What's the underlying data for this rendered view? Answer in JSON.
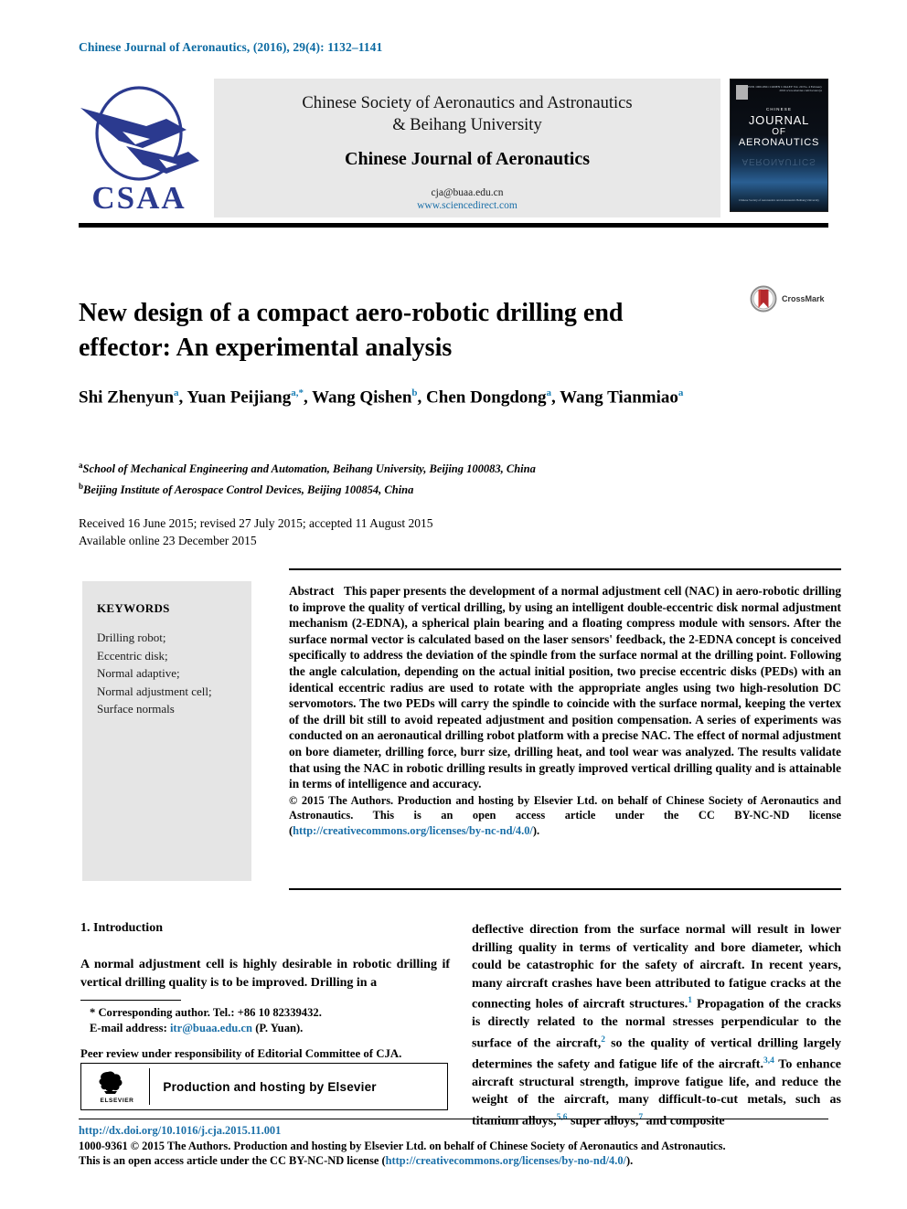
{
  "running_head": "Chinese Journal of Aeronautics, (2016), 29(4): 1132–1141",
  "masthead": {
    "logo_text": "CSAA",
    "society_line1": "Chinese Society of Aeronautics and Astronautics",
    "society_line2": "& Beihang University",
    "journal_name": "Chinese Journal of Aeronautics",
    "email": "cja@buaa.edu.cn",
    "url": "www.sciencedirect.com",
    "cover": {
      "line_chinese": "CHINESE",
      "line1": "JOURNAL",
      "line2": "OF",
      "line3": "AERONAUTICS",
      "issn": "ISSN 1000-9361\nCODEN CJOAEY\nVol. 29 No. 4 February 2016\nwww.elsevier.com/locate/cja",
      "bottom": "Chinese Society of Aeronautics and Astronautics\nBeihang University"
    }
  },
  "title": "New design of a compact aero-robotic drilling end effector: An experimental analysis",
  "crossmark_label": "CrossMark",
  "authors_html": "Shi Zhenyun<sup>a</sup>, Yuan Peijiang<sup>a,*</sup>, Wang Qishen<sup>b</sup>, Chen Dongdong<sup>a</sup>, Wang Tianmiao<sup>a</sup>",
  "affiliations": [
    {
      "marker": "a",
      "text": "School of Mechanical Engineering and Automation, Beihang University, Beijing 100083, China"
    },
    {
      "marker": "b",
      "text": "Beijing Institute of Aerospace Control Devices, Beijing 100854, China"
    }
  ],
  "dates": {
    "line1": "Received 16 June 2015; revised 27 July 2015; accepted 11 August 2015",
    "line2": "Available online 23 December 2015"
  },
  "keywords": {
    "heading": "KEYWORDS",
    "items": [
      "Drilling robot;",
      "Eccentric disk;",
      "Normal adaptive;",
      "Normal adjustment cell;",
      "Surface normals"
    ]
  },
  "abstract": {
    "label": "Abstract",
    "body": "This paper presents the development of a normal adjustment cell (NAC) in aero-robotic drilling to improve the quality of vertical drilling, by using an intelligent double-eccentric disk normal adjustment mechanism (2-EDNA), a spherical plain bearing and a floating compress module with sensors. After the surface normal vector is calculated based on the laser sensors' feedback, the 2-EDNA concept is conceived specifically to address the deviation of the spindle from the surface normal at the drilling point. Following the angle calculation, depending on the actual initial position, two precise eccentric disks (PEDs) with an identical eccentric radius are used to rotate with the appropriate angles using two high-resolution DC servomotors. The two PEDs will carry the spindle to coincide with the surface normal, keeping the vertex of the drill bit still to avoid repeated adjustment and position compensation. A series of experiments was conducted on an aeronautical drilling robot platform with a precise NAC. The effect of normal adjustment on bore diameter, drilling force, burr size, drilling heat, and tool wear was analyzed. The results validate that using the NAC in robotic drilling results in greatly improved vertical drilling quality and is attainable in terms of intelligence and accuracy.",
    "copyright_text": "© 2015 The Authors. Production and hosting by Elsevier Ltd. on behalf of Chinese Society of Aeronautics and Astronautics. This is an open access article under the CC BY-NC-ND license (",
    "copyright_link": "http://creativecommons.org/licenses/by-nc-nd/4.0/",
    "copyright_tail": ")."
  },
  "introduction": {
    "heading": "1. Introduction",
    "left_paragraph": "A normal adjustment cell is highly desirable in robotic drilling if vertical drilling quality is to be improved. Drilling in a"
  },
  "right_column_html": "deflective direction from the surface normal will result in lower drilling quality in terms of verticality and bore diameter, which could be catastrophic for the safety of aircraft. In recent years, many aircraft crashes have been attributed to fatigue cracks at the connecting holes of aircraft structures.<sup>1</sup> Propagation of the cracks is directly related to the normal stresses perpendicular to the surface of the aircraft,<sup>2</sup> so the quality of vertical drilling largely determines the safety and fatigue life of the aircraft.<sup>3,4</sup> To enhance aircraft structural strength, improve fatigue life, and reduce the weight of the aircraft, many difficult-to-cut metals, such as titanium alloys,<sup>5,6</sup> super alloys,<sup>7</sup> and composite",
  "footnotes": {
    "corresponding": "* Corresponding author. Tel.: +86 10 82339432.",
    "email_label": "E-mail address:",
    "email": "itr@buaa.edu.cn",
    "email_tail": "(P. Yuan).",
    "peer_review": "Peer review under responsibility of Editorial Committee of CJA."
  },
  "elsevier_box": {
    "logo_word": "ELSEVIER",
    "text": "Production and hosting by Elsevier"
  },
  "footer": {
    "doi": "http://dx.doi.org/10.1016/j.cja.2015.11.001",
    "line2": "1000-9361 © 2015 The Authors. Production and hosting by Elsevier Ltd. on behalf of Chinese Society of Aeronautics and Astronautics.",
    "line3_pre": "This is an open access article under the CC BY-NC-ND license (",
    "line3_link": "http://creativecommons.org/licenses/by-no-nd/4.0/",
    "line3_tail": ")."
  },
  "colors": {
    "header_blue": "#0b6aa2",
    "link_blue": "#1a6fa8",
    "superscript_blue": "#1a7fb5",
    "keyword_box_gray": "#e5e5e5",
    "masthead_gray": "#e8e8e8",
    "csaa_navy": "#2b3a8f"
  }
}
